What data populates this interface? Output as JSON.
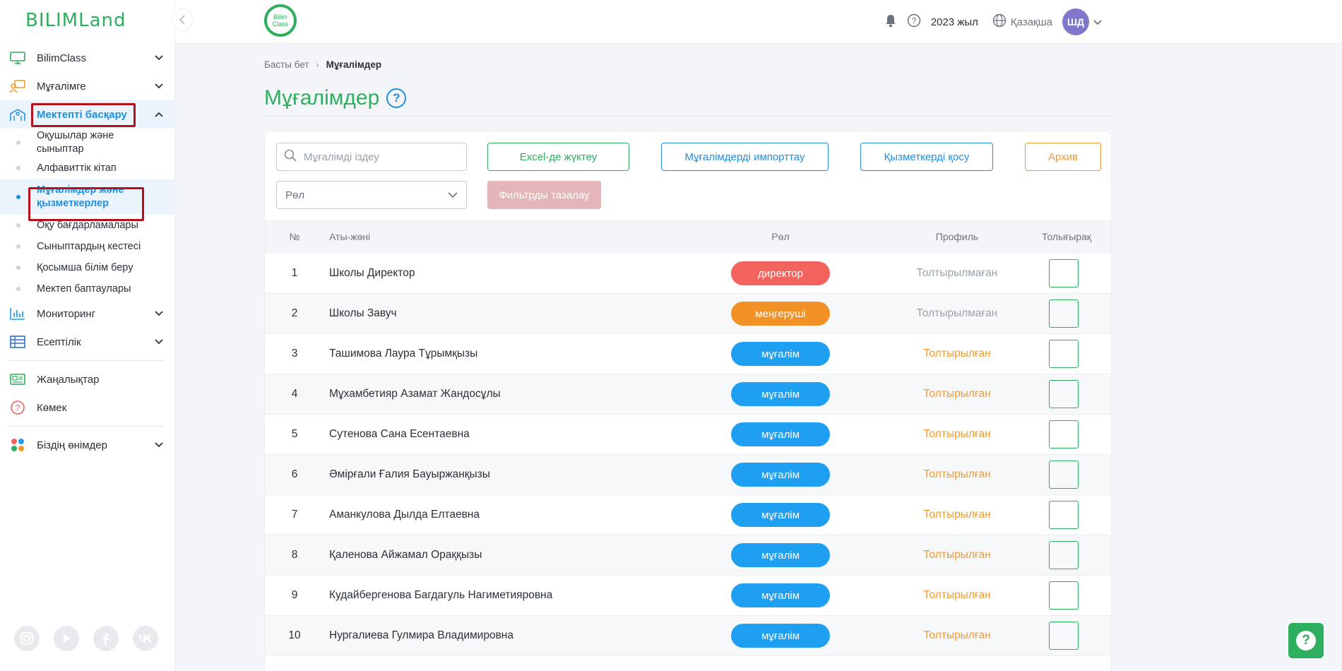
{
  "brand": {
    "logo": "BILIMLand",
    "class_logo": "Bilim Class"
  },
  "sidebar": {
    "items": [
      {
        "label": "BilimClass",
        "icon": "monitor-icon"
      },
      {
        "label": "Мұғалімге",
        "icon": "teacher-icon"
      },
      {
        "label": "Мектепті басқару",
        "icon": "school-icon"
      },
      {
        "label": "Мониторинг",
        "icon": "bar-chart-icon"
      },
      {
        "label": "Есептілік",
        "icon": "table-icon"
      },
      {
        "label": "Жаңалықтар",
        "icon": "news-icon"
      },
      {
        "label": "Көмек",
        "icon": "help-icon"
      },
      {
        "label": "Біздің өнімдер",
        "icon": "products-icon"
      }
    ],
    "subitems": [
      "Оқушылар және сыныптар",
      "Алфавиттік кітап",
      "Мұғалімдер және қызметкерлер",
      "Оқу бағдарламалары",
      "Сыныптардың кестесі",
      "Қосымша білім беру",
      "Мектеп баптаулары"
    ]
  },
  "header": {
    "year": "2023 жыл",
    "language": "Қазақша",
    "avatar": "ШД"
  },
  "breadcrumb": {
    "home": "Басты бет",
    "current": "Мұғалімдер"
  },
  "page_title": "Мұғалімдер",
  "toolbar": {
    "search_placeholder": "Мұғалімді іздеу",
    "excel": "Excel-де жүктеу",
    "import": "Мұғалімдерді импорттау",
    "add_staff": "Қызметкерді қосу",
    "archive": "Архив",
    "role_select": "Рөл",
    "clear_filters": "Фильтрды тазалау"
  },
  "table": {
    "headers": {
      "num": "№",
      "name": "Аты-жөні",
      "role": "Рөл",
      "profile": "Профиль",
      "more": "Толығырақ"
    },
    "rows": [
      {
        "num": "1",
        "name": "Школы Директор",
        "role": "директор",
        "role_color": "#f2635e",
        "profile": "Толтырылмаған",
        "filled": false
      },
      {
        "num": "2",
        "name": "Школы Завуч",
        "role": "меңгеруші",
        "role_color": "#f29226",
        "profile": "Толтырылмаған",
        "filled": false
      },
      {
        "num": "3",
        "name": "Ташимова Лаура Тұрымқызы",
        "role": "мұғалім",
        "role_color": "#1e9ff2",
        "profile": "Толтырылған",
        "filled": true
      },
      {
        "num": "4",
        "name": "Мұхамбетияр Азамат Жандосұлы",
        "role": "мұғалім",
        "role_color": "#1e9ff2",
        "profile": "Толтырылған",
        "filled": true
      },
      {
        "num": "5",
        "name": "Сутенова Сана Есентаевна",
        "role": "мұғалім",
        "role_color": "#1e9ff2",
        "profile": "Толтырылған",
        "filled": true
      },
      {
        "num": "6",
        "name": "Әмірғали Ғалия Бауыржанқызы",
        "role": "мұғалім",
        "role_color": "#1e9ff2",
        "profile": "Толтырылған",
        "filled": true
      },
      {
        "num": "7",
        "name": "Аманкулова Дылда Елтаевна",
        "role": "мұғалім",
        "role_color": "#1e9ff2",
        "profile": "Толтырылған",
        "filled": true
      },
      {
        "num": "8",
        "name": "Қаленова Айжамал Ораққызы",
        "role": "мұғалім",
        "role_color": "#1e9ff2",
        "profile": "Толтырылған",
        "filled": true
      },
      {
        "num": "9",
        "name": "Кудайбергенова Багдагуль Нагиметияровна",
        "role": "мұғалім",
        "role_color": "#1e9ff2",
        "profile": "Толтырылған",
        "filled": true
      },
      {
        "num": "10",
        "name": "Нургалиева Гулмира Владимировна",
        "role": "мұғалім",
        "role_color": "#1e9ff2",
        "profile": "Толтырылған",
        "filled": true
      }
    ]
  },
  "colors": {
    "brand_green": "#2eae5f",
    "accent_blue": "#1f8fe0",
    "orange": "#f29a2e",
    "highlight_red": "#b3121d"
  }
}
